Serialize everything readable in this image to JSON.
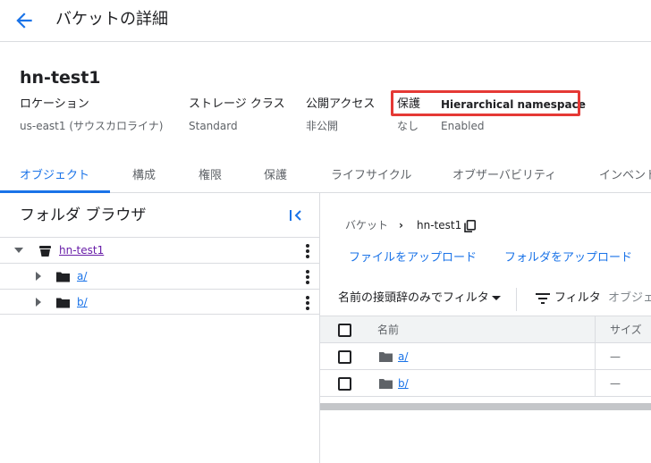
{
  "header": {
    "title": "バケットの詳細"
  },
  "bucket": {
    "name": "hn-test1"
  },
  "properties": [
    {
      "label": "ロケーション",
      "value": "us-east1 (サウスカロライナ)"
    },
    {
      "label": "ストレージ クラス",
      "value": "Standard"
    },
    {
      "label": "公開アクセス",
      "value": "非公開"
    },
    {
      "label": "保護",
      "value": "なし"
    },
    {
      "label": "Hierarchical namespace",
      "value": "Enabled"
    }
  ],
  "tabs": [
    "オブジェクト",
    "構成",
    "権限",
    "保護",
    "ライフサイクル",
    "オブザーバビリティ",
    "インベント"
  ],
  "folder_browser": {
    "title": "フォルダ ブラウザ",
    "root": "hn-test1",
    "children": [
      "a/",
      "b/"
    ]
  },
  "breadcrumb": {
    "root": "バケット",
    "separator": "›",
    "current": "hn-test1"
  },
  "actions": {
    "upload_files": "ファイルをアップロード",
    "upload_folder": "フォルダをアップロード"
  },
  "filter_bar": {
    "prefix_filter": "名前の接頭辞のみでフィルタ",
    "filter_label": "フィルタ",
    "filter_placeholder": "オブジェ"
  },
  "table": {
    "headers": {
      "name": "名前",
      "size": "サイズ"
    },
    "rows": [
      {
        "name": "a/",
        "size": "—"
      },
      {
        "name": "b/",
        "size": "—"
      }
    ]
  },
  "colors": {
    "accent": "#1a73e8",
    "highlight": "#e53935",
    "visited_link": "#681da8"
  },
  "icons": [
    "back-arrow-icon",
    "copy-icon",
    "bucket-icon",
    "folder-icon",
    "collapse-panel-icon",
    "filter-icon",
    "more-vert-icon",
    "expand-arrow-icon"
  ]
}
